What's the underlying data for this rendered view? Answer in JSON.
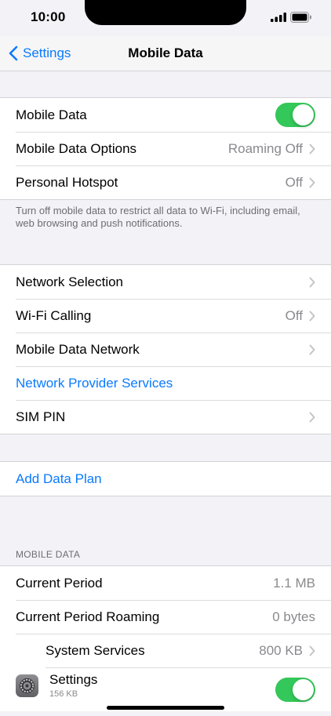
{
  "status": {
    "time": "10:00"
  },
  "nav": {
    "back_label": "Settings",
    "title": "Mobile Data"
  },
  "group1": {
    "mobile_data": {
      "label": "Mobile Data",
      "on": true
    },
    "options": {
      "label": "Mobile Data Options",
      "value": "Roaming Off"
    },
    "hotspot": {
      "label": "Personal Hotspot",
      "value": "Off"
    }
  },
  "footnote": "Turn off mobile data to restrict all data to Wi-Fi, including email, web browsing and push notifications.",
  "group2": {
    "network_selection": {
      "label": "Network Selection"
    },
    "wifi_calling": {
      "label": "Wi-Fi Calling",
      "value": "Off"
    },
    "mobile_data_network": {
      "label": "Mobile Data Network"
    },
    "provider_services": {
      "label": "Network Provider Services"
    },
    "sim_pin": {
      "label": "SIM PIN"
    }
  },
  "group3": {
    "add_plan": {
      "label": "Add Data Plan"
    }
  },
  "usage": {
    "header": "MOBILE DATA",
    "current_period": {
      "label": "Current Period",
      "value": "1.1 MB"
    },
    "current_period_roaming": {
      "label": "Current Period Roaming",
      "value": "0 bytes"
    },
    "system_services": {
      "label": "System Services",
      "value": "800 KB"
    },
    "settings_app": {
      "label": "Settings",
      "sub": "156 KB",
      "icon": "settings-gear-icon",
      "on": true
    }
  },
  "colors": {
    "accent": "#0a7aff",
    "toggle_on": "#34c759",
    "background": "#f2f2f7"
  }
}
